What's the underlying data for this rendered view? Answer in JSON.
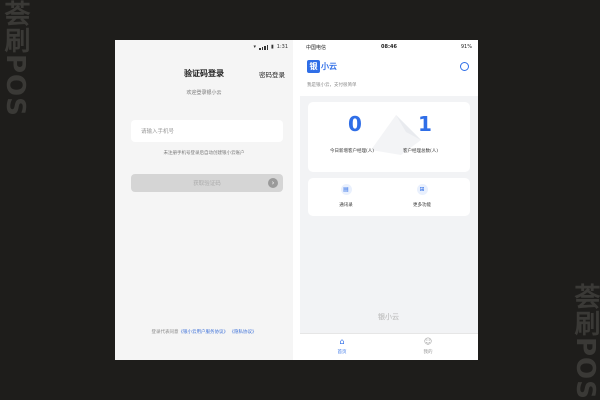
{
  "watermark": {
    "text": "荟刷POS"
  },
  "colors": {
    "accent": "#2f6ee7",
    "page_bg": "#1e1d1b"
  },
  "login_screen": {
    "status_time": "1:31",
    "title": "验证码登录",
    "switch_label": "密码登录",
    "welcome": "欢迎登录银小云",
    "phone_placeholder": "请输入手机号",
    "tip": "未注册手机号登录后自动创建银小云账户",
    "button_label": "获取验证码",
    "agreement_prefix": "登录代表同意",
    "agreement_link1": "《银小云用户服务协议》",
    "agreement_link2": "《隐私协议》"
  },
  "home_screen": {
    "status_carrier": "中国电信",
    "status_time": "08:46",
    "status_battery": "91%",
    "logo_mark": "银",
    "logo_text": "小云",
    "subtitle": "我是银小云，支付很简单",
    "stats": [
      {
        "value": "0",
        "label": "今日新增客户经理(人)"
      },
      {
        "value": "1",
        "label": "客户经理总数(人)"
      }
    ],
    "functions": [
      {
        "label": "通讯录",
        "icon": "contacts-icon"
      },
      {
        "label": "更多功能",
        "icon": "grid-icon"
      }
    ],
    "bottom_logo": "银小云",
    "tabs": [
      {
        "label": "首页",
        "icon": "home-icon",
        "active": true
      },
      {
        "label": "我的",
        "icon": "user-icon",
        "active": false
      }
    ]
  }
}
